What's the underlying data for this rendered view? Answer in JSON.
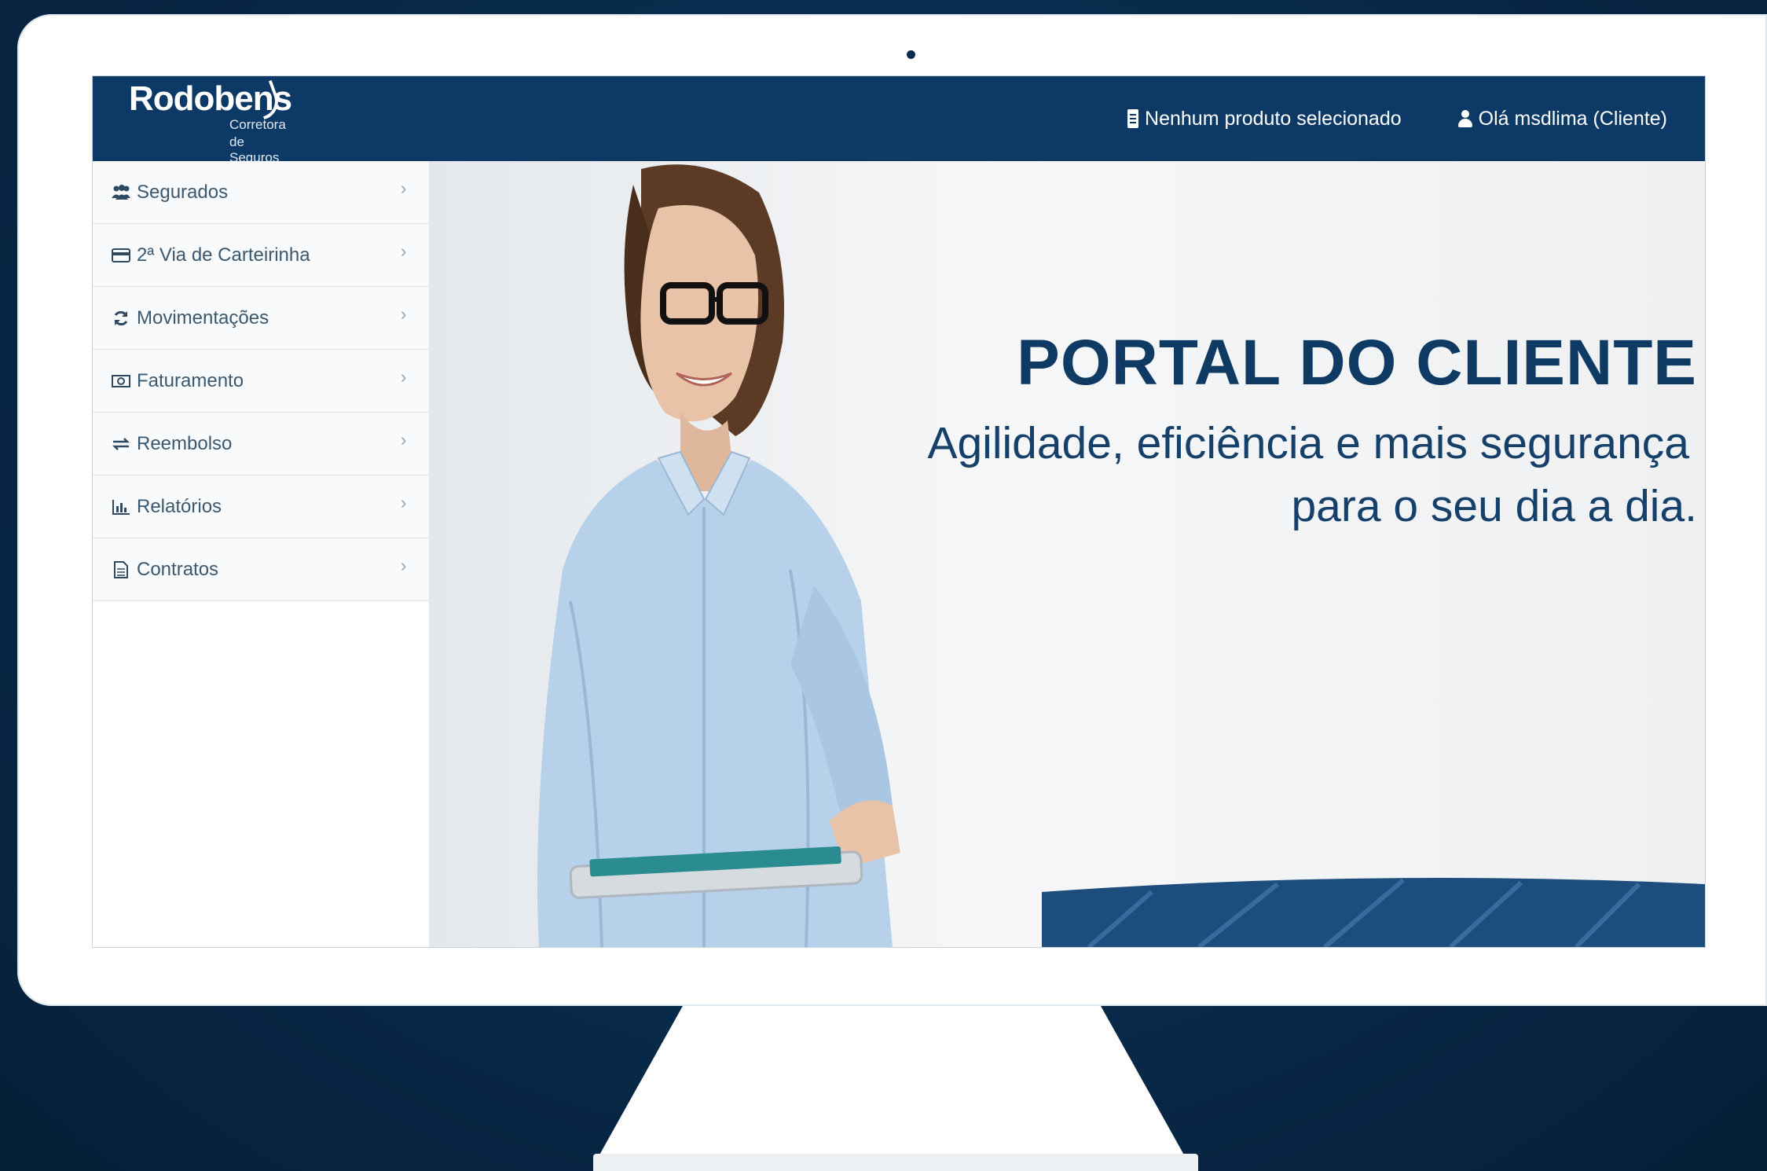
{
  "brand": {
    "name": "Rodobens",
    "sub1": "Corretora",
    "sub2": "de Seguros"
  },
  "topbar": {
    "product_icon": "document-icon",
    "product_label": "Nenhum produto selecionado",
    "user_icon": "user-icon",
    "user_label": "Olá msdlima (Cliente)"
  },
  "sidebar": {
    "items": [
      {
        "label": "Segurados",
        "icon": "users-icon"
      },
      {
        "label": "2ª Via de Carteirinha",
        "icon": "card-icon"
      },
      {
        "label": "Movimentações",
        "icon": "refresh-icon"
      },
      {
        "label": "Faturamento",
        "icon": "money-icon"
      },
      {
        "label": "Reembolso",
        "icon": "exchange-icon"
      },
      {
        "label": "Relatórios",
        "icon": "bar-chart-icon"
      },
      {
        "label": "Contratos",
        "icon": "file-icon"
      }
    ]
  },
  "hero": {
    "title": "PORTAL DO CLIENTE",
    "subtitle_line1": "Agilidade, eficiência e mais segurança",
    "subtitle_line2": "para o seu dia a dia."
  },
  "colors": {
    "navy": "#0d3966",
    "background": "#082a4a",
    "title": "#0e3a63"
  }
}
